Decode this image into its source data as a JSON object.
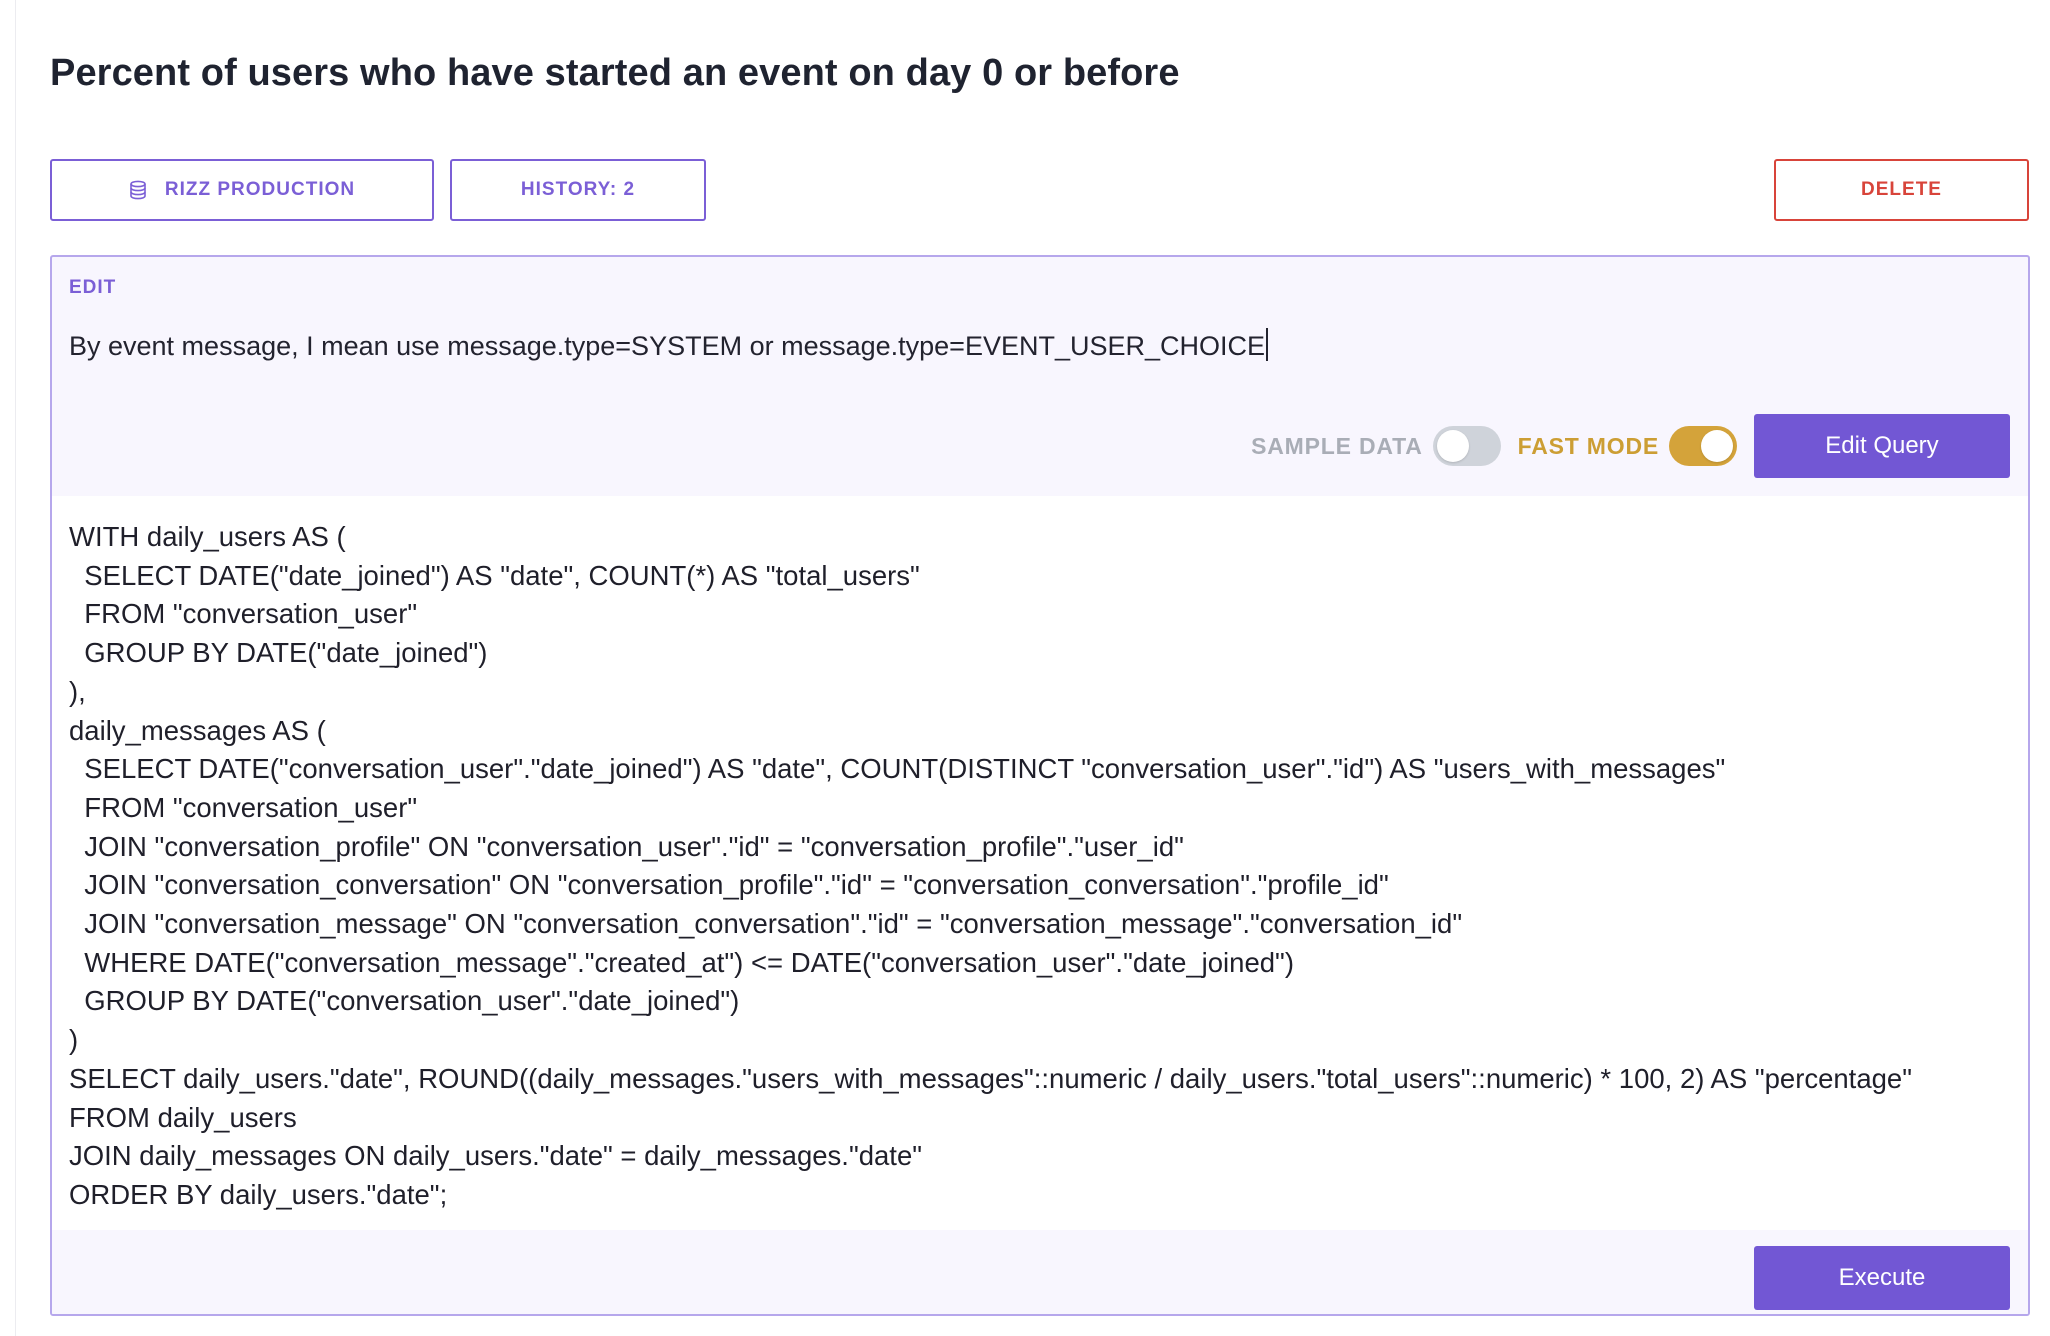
{
  "page": {
    "title": "Percent of users who have started an event on day 0 or before"
  },
  "toolbar": {
    "database_label": "RIZZ PRODUCTION",
    "database_icon": "database-icon",
    "history_label": "HISTORY: 2",
    "delete_label": "DELETE"
  },
  "editor": {
    "section_label": "EDIT",
    "prompt_text": "By event message, I mean use message.type=SYSTEM or message.type=EVENT_USER_CHOICE",
    "sample_data_label": "SAMPLE DATA",
    "sample_data_enabled": false,
    "fast_mode_label": "FAST MODE",
    "fast_mode_enabled": true,
    "edit_query_label": "Edit Query",
    "execute_label": "Execute"
  },
  "query": {
    "lines": [
      "WITH daily_users AS (",
      "  SELECT DATE(\"date_joined\") AS \"date\", COUNT(*) AS \"total_users\"",
      "  FROM \"conversation_user\"",
      "  GROUP BY DATE(\"date_joined\")",
      "),",
      "daily_messages AS (",
      "  SELECT DATE(\"conversation_user\".\"date_joined\") AS \"date\", COUNT(DISTINCT \"conversation_user\".\"id\") AS \"users_with_messages\"",
      "  FROM \"conversation_user\"",
      "  JOIN \"conversation_profile\" ON \"conversation_user\".\"id\" = \"conversation_profile\".\"user_id\"",
      "  JOIN \"conversation_conversation\" ON \"conversation_profile\".\"id\" = \"conversation_conversation\".\"profile_id\"",
      "  JOIN \"conversation_message\" ON \"conversation_conversation\".\"id\" = \"conversation_message\".\"conversation_id\"",
      "  WHERE DATE(\"conversation_message\".\"created_at\") <= DATE(\"conversation_user\".\"date_joined\")",
      "  GROUP BY DATE(\"conversation_user\".\"date_joined\")",
      ")",
      "SELECT daily_users.\"date\", ROUND((daily_messages.\"users_with_messages\"::numeric / daily_users.\"total_users\"::numeric) * 100, 2) AS \"percentage\"",
      "FROM daily_users",
      "JOIN daily_messages ON daily_users.\"date\" = daily_messages.\"date\"",
      "ORDER BY daily_users.\"date\";"
    ]
  }
}
